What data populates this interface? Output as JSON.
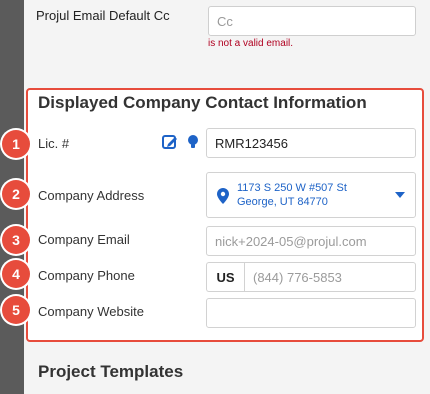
{
  "email": {
    "label": "Projul Email Default Cc",
    "placeholder": "Cc",
    "error": "is not a valid email."
  },
  "section": {
    "title": "Displayed Company Contact Information"
  },
  "fields": [
    {
      "badge": "1",
      "label": "Lic. #",
      "value": "RMR123456"
    },
    {
      "badge": "2",
      "label": "Company Address",
      "value": "1173 S 250 W #507 St George, UT 84770"
    },
    {
      "badge": "3",
      "label": "Company Email",
      "placeholder": "nick+2024-05@projul.com"
    },
    {
      "badge": "4",
      "label": "Company Phone",
      "country": "US",
      "placeholder": "(844) 776-5853"
    },
    {
      "badge": "5",
      "label": "Company Website",
      "value": ""
    }
  ],
  "footer": {
    "title": "Project Templates"
  },
  "colors": {
    "highlight": "#e74c3c",
    "accent_blue": "#1e63c7"
  },
  "icons": {
    "edit": "edit-icon",
    "bulb": "lightbulb-icon",
    "pin": "map-pin-icon",
    "caret": "chevron-down-icon"
  }
}
